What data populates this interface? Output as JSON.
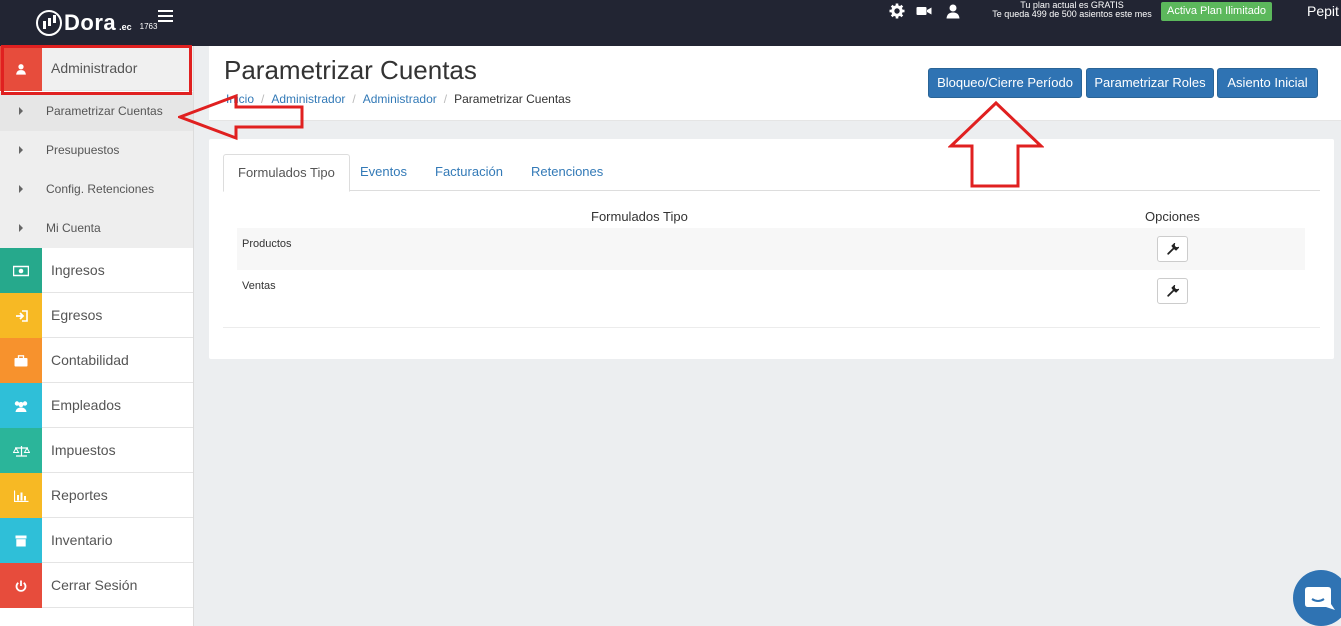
{
  "topbar": {
    "logo_text": "Dora",
    "logo_suffix": ".ec",
    "logo_number": "1763",
    "icons": [
      "gear-icon",
      "video-camera-icon",
      "user-icon"
    ],
    "plan_line1": "Tu plan actual es GRATIS",
    "plan_line2": "Te queda 499 de 500 asientos este mes",
    "plan_button": "Activa Plan Ilimitado",
    "user_name": "Pepit"
  },
  "sidebar": {
    "admin": {
      "label": "Administrador",
      "icon": "user-icon",
      "color": "#e74c3c"
    },
    "sub_items": [
      {
        "label": "Parametrizar Cuentas"
      },
      {
        "label": "Presupuestos"
      },
      {
        "label": "Config. Retenciones"
      },
      {
        "label": "Mi Cuenta"
      }
    ],
    "items": [
      {
        "label": "Ingresos",
        "icon": "money-icon",
        "color": "#26a98c"
      },
      {
        "label": "Egresos",
        "icon": "sign-in-icon",
        "color": "#f7b924"
      },
      {
        "label": "Contabilidad",
        "icon": "briefcase-icon",
        "color": "#f7922d"
      },
      {
        "label": "Empleados",
        "icon": "users-icon",
        "color": "#2fbfd8"
      },
      {
        "label": "Impuestos",
        "icon": "balance-scale-icon",
        "color": "#2bb59a"
      },
      {
        "label": "Reportes",
        "icon": "bar-chart-icon",
        "color": "#f7b924"
      },
      {
        "label": "Inventario",
        "icon": "box-icon",
        "color": "#2fbfd8"
      },
      {
        "label": "Cerrar Sesión",
        "icon": "power-icon",
        "color": "#e74c3c"
      }
    ]
  },
  "header": {
    "title": "Parametrizar Cuentas",
    "breadcrumb": [
      "Inicio",
      "Administrador",
      "Administrador",
      "Parametrizar Cuentas"
    ],
    "buttons": [
      "Bloqueo/Cierre Período",
      "Parametrizar Roles",
      "Asiento Inicial"
    ]
  },
  "tabs": [
    "Formulados Tipo",
    "Eventos",
    "Facturación",
    "Retenciones"
  ],
  "table": {
    "headers": [
      "Formulados Tipo",
      "Opciones"
    ],
    "rows": [
      {
        "name": "Productos",
        "action_icon": "wrench-icon"
      },
      {
        "name": "Ventas",
        "action_icon": "wrench-icon"
      }
    ]
  },
  "colors": {
    "topbar": "#222533",
    "primary_button": "#2f73b3",
    "annotation_red": "#e02020",
    "plan_button": "#5cb85c"
  }
}
